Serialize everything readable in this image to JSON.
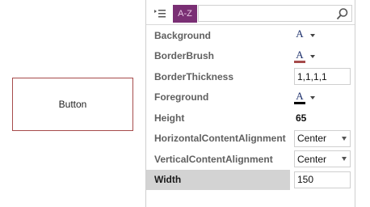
{
  "designer": {
    "button_label": "Button"
  },
  "toolbar": {
    "categorized_icon": "list-icon",
    "alphabetical_label": "A-Z",
    "search_icon": "magnifier-icon",
    "search_value": ""
  },
  "properties": [
    {
      "name": "Background",
      "kind": "brush",
      "brush_color": "#ffffff",
      "letter": "A"
    },
    {
      "name": "BorderBrush",
      "kind": "brush",
      "brush_color": "#a64b4b",
      "letter": "A"
    },
    {
      "name": "BorderThickness",
      "kind": "text",
      "value": "1,1,1,1"
    },
    {
      "name": "Foreground",
      "kind": "brush",
      "brush_color": "#000000",
      "letter": "A"
    },
    {
      "name": "Height",
      "kind": "plain",
      "value": "65"
    },
    {
      "name": "HorizontalContentAlignment",
      "kind": "combo",
      "value": "Center"
    },
    {
      "name": "VerticalContentAlignment",
      "kind": "combo",
      "value": "Center"
    },
    {
      "name": "Width",
      "kind": "plain",
      "value": "150",
      "selected": true
    }
  ],
  "colors": {
    "accent": "#7a2f74",
    "selection": "#d3d3d3",
    "border_brush": "#a64b4b"
  }
}
